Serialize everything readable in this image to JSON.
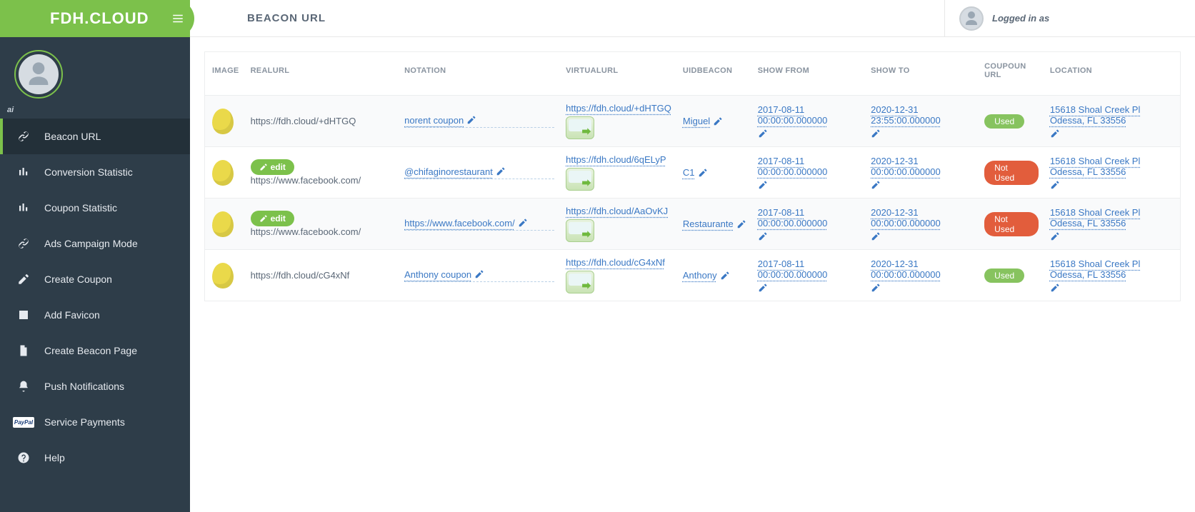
{
  "brand": "FDH.CLOUD",
  "ai_label": "ai",
  "page_title": "BEACON URL",
  "logged_in": "Logged in as",
  "nav": [
    {
      "label": "Beacon URL",
      "icon": "link"
    },
    {
      "label": "Conversion Statistic",
      "icon": "bars"
    },
    {
      "label": "Coupon Statistic",
      "icon": "bars"
    },
    {
      "label": "Ads Campaign Mode",
      "icon": "link"
    },
    {
      "label": "Create Coupon",
      "icon": "edit"
    },
    {
      "label": "Add Favicon",
      "icon": "image"
    },
    {
      "label": "Create Beacon Page",
      "icon": "page"
    },
    {
      "label": "Push Notifications",
      "icon": "bell"
    },
    {
      "label": "Service Payments",
      "icon": "paypal"
    },
    {
      "label": "Help",
      "icon": "help"
    }
  ],
  "edit_label": "edit",
  "headers": {
    "image": "IMAGE",
    "realurl": "REALURL",
    "notation": "NOTATION",
    "virtualurl": "VIRTUALURL",
    "uidbeacon": "UIDBEACON",
    "showfrom": "SHOW FROM",
    "showto": "SHOW TO",
    "coupon": "COUPOUN URL",
    "location": "LOCATION"
  },
  "rows": [
    {
      "realurl": "https://fdh.cloud/+dHTGQ",
      "has_edit": false,
      "notation": "norent coupon",
      "virtualurl": "https://fdh.cloud/+dHTGQ",
      "uid": "Miguel",
      "from": "2017-08-11 00:00:00.000000",
      "to": "2020-12-31 23:55:00.000000",
      "status": "Used",
      "status_class": "used",
      "location": "15618 Shoal Creek Pl Odessa, FL 33556"
    },
    {
      "realurl": "https://www.facebook.com/",
      "has_edit": true,
      "notation": "@chifaginorestaurant",
      "virtualurl": "https://fdh.cloud/6qELyP",
      "uid": "C1",
      "from": "2017-08-11 00:00:00.000000",
      "to": "2020-12-31 00:00:00.000000",
      "status": "Not Used",
      "status_class": "notused",
      "location": "15618 Shoal Creek Pl Odessa, FL 33556"
    },
    {
      "realurl": "https://www.facebook.com/",
      "has_edit": true,
      "notation": "https://www.facebook.com/",
      "virtualurl": "https://fdh.cloud/AaOvKJ",
      "uid": "Restaurante",
      "from": "2017-08-11 00:00:00.000000",
      "to": "2020-12-31 00:00:00.000000",
      "status": "Not Used",
      "status_class": "notused",
      "location": "15618 Shoal Creek Pl Odessa, FL 33556"
    },
    {
      "realurl": "https://fdh.cloud/cG4xNf",
      "has_edit": false,
      "notation": "Anthony coupon",
      "virtualurl": "https://fdh.cloud/cG4xNf",
      "uid": "Anthony",
      "from": "2017-08-11 00:00:00.000000",
      "to": "2020-12-31 00:00:00.000000",
      "status": "Used",
      "status_class": "used",
      "location": "15618 Shoal Creek Pl Odessa, FL 33556"
    }
  ]
}
